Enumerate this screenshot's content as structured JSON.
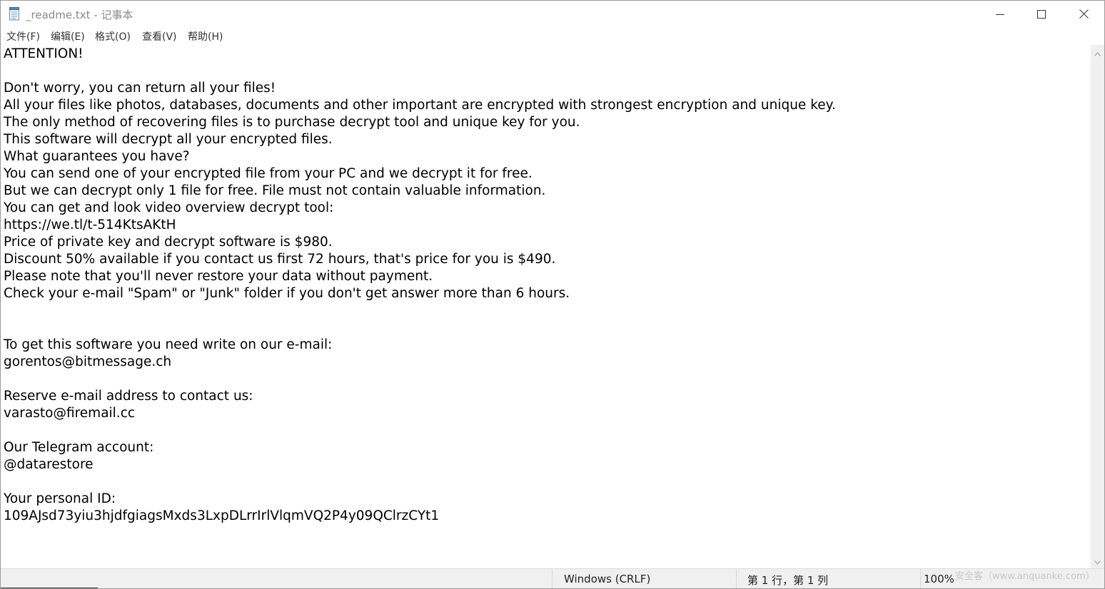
{
  "window": {
    "title": "_readme.txt - 记事本",
    "app_icon": "notepad-icon",
    "controls": [
      "minimize-icon",
      "maximize-icon",
      "close-icon"
    ]
  },
  "menu": [
    {
      "label": "文件(F)"
    },
    {
      "label": "编辑(E)"
    },
    {
      "label": "格式(O)"
    },
    {
      "label": "查看(V)"
    },
    {
      "label": "帮助(H)"
    }
  ],
  "document": {
    "lines": [
      "ATTENTION!",
      "",
      "Don't worry, you can return all your files!",
      "All your files like photos, databases, documents and other important are encrypted with strongest encryption and unique key.",
      "The only method of recovering files is to purchase decrypt tool and unique key for you.",
      "This software will decrypt all your encrypted files.",
      "What guarantees you have?",
      "You can send one of your encrypted file from your PC and we decrypt it for free.",
      "But we can decrypt only 1 file for free. File must not contain valuable information.",
      "You can get and look video overview decrypt tool:",
      "https://we.tl/t-514KtsAKtH",
      "Price of private key and decrypt software is $980.",
      "Discount 50% available if you contact us first 72 hours, that's price for you is $490.",
      "Please note that you'll never restore your data without payment.",
      "Check your e-mail \"Spam\" or \"Junk\" folder if you don't get answer more than 6 hours.",
      "",
      "",
      "To get this software you need write on our e-mail:",
      "gorentos@bitmessage.ch",
      "",
      "Reserve e-mail address to contact us:",
      "varasto@firemail.cc",
      "",
      "Our Telegram account:",
      "@datarestore",
      "",
      "Your personal ID:",
      "109AJsd73yiu3hjdfgiagsMxds3LxpDLrrIrlVlqmVQ2P4y09QClrzCYt1"
    ]
  },
  "statusbar": {
    "line_ending": "Windows (CRLF)",
    "position": "第 1 行，第 1 列",
    "zoom": "100%"
  },
  "watermark": "安全客（www.anquanke.com）"
}
